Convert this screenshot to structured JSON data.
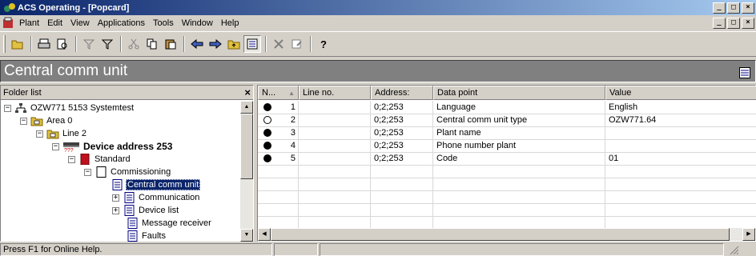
{
  "window": {
    "title": "ACS Operating - [Popcard]",
    "minimize": "_",
    "restore": "□",
    "close": "×"
  },
  "menu": {
    "items": [
      "Plant",
      "Edit",
      "View",
      "Applications",
      "Tools",
      "Window",
      "Help"
    ]
  },
  "header": {
    "title": "Central comm unit"
  },
  "folder_panel": {
    "title": "Folder list",
    "close": "×",
    "tree": [
      {
        "label": "OZW771 5153 Systemtest",
        "expander": "−"
      },
      {
        "label": "Area 0",
        "expander": "−"
      },
      {
        "label": "Line 2",
        "expander": "−"
      },
      {
        "label": "Device address 253",
        "expander": "−"
      },
      {
        "label": "Standard",
        "expander": "−"
      },
      {
        "label": "Commissioning",
        "expander": "−"
      },
      {
        "label": "Central comm unit",
        "expander": ""
      },
      {
        "label": "Communication",
        "expander": "+"
      },
      {
        "label": "Device list",
        "expander": "+"
      },
      {
        "label": "Message receiver",
        "expander": ""
      },
      {
        "label": "Faults",
        "expander": ""
      }
    ]
  },
  "grid": {
    "columns": [
      "N...",
      "Line no.",
      "Address:",
      "Data point",
      "Value"
    ],
    "sort_indicator": "▲",
    "rows": [
      {
        "status": "filled",
        "line": "1",
        "address": "0;2;253",
        "datapoint": "Language",
        "value": "English"
      },
      {
        "status": "open",
        "line": "2",
        "address": "0;2;253",
        "datapoint": "Central comm unit type",
        "value": "OZW771.64"
      },
      {
        "status": "filled",
        "line": "3",
        "address": "0;2;253",
        "datapoint": "Plant name",
        "value": ""
      },
      {
        "status": "filled",
        "line": "4",
        "address": "0;2;253",
        "datapoint": "Phone number plant",
        "value": ""
      },
      {
        "status": "filled",
        "line": "5",
        "address": "0;2;253",
        "datapoint": "Code",
        "value": "01"
      }
    ]
  },
  "status": {
    "text": "Press F1 for Online Help."
  }
}
